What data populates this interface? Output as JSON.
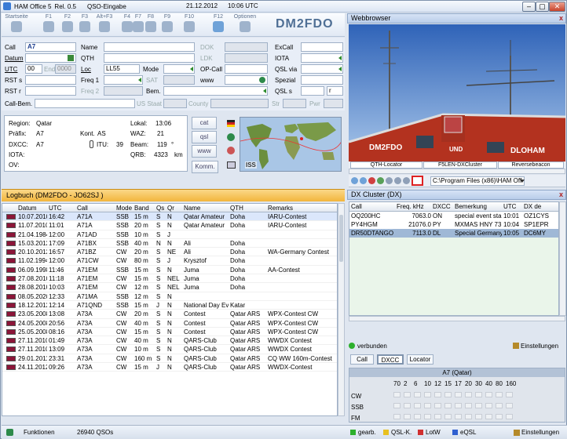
{
  "window": {
    "app": "HAM Office 5",
    "release": "Rel. 0.5",
    "module": "QSO-Eingabe",
    "date": "21.12.2012",
    "time": "10:06 UTC"
  },
  "toolbar": {
    "buttons": [
      {
        "key": "Startseite",
        "icon": "home-icon"
      },
      {
        "key": "F1",
        "icon": "help-icon"
      },
      {
        "key": "F2",
        "icon": "clock-icon"
      },
      {
        "key": "F3",
        "icon": "tune-icon"
      },
      {
        "key": "Alt+F3",
        "icon": "wrench-icon"
      },
      {
        "key": "F4",
        "icon": "edit-icon"
      },
      {
        "key": "F7",
        "icon": "edit2-icon"
      },
      {
        "key": "F8",
        "icon": "settings-icon"
      },
      {
        "key": "F9",
        "icon": "save-icon"
      },
      {
        "key": "F10",
        "icon": "window-icon"
      },
      {
        "key": "F12",
        "icon": "refresh-icon"
      },
      {
        "key": "Optionen",
        "icon": "tools-icon"
      }
    ],
    "own_call": "DM2FDO"
  },
  "form": {
    "call_label": "Call",
    "call_value": "A7",
    "name_label": "Name",
    "dok_label": "DOK",
    "excall_label": "ExCall",
    "datum_label": "Datum",
    "qth_label": "QTH",
    "ldk_label": "LDK",
    "iota_label": "IOTA",
    "utc_label": "UTC",
    "utc_value": "00",
    "end_label": "End",
    "end_value": "0000",
    "loc_label": "Loc",
    "loc_value": "LL55",
    "mode_label": "Mode",
    "opcall_label": "OP-Call",
    "qslvia_label": "QSL via",
    "rsts_label": "RST s",
    "freq1_label": "Freq 1",
    "sat_label": "SAT",
    "www_label": "www",
    "spezial_label": "Spezial",
    "rstr_label": "RST r",
    "freq2_label": "Freq 2",
    "bem_label": "Bem.",
    "qsls_label": "QSL s",
    "qsls_value": "r",
    "callbem_label": "Call-Bem.",
    "usstaat_label": "US Staat",
    "country_label": "County",
    "str_label": "Str",
    "pwr_label": "Pwr"
  },
  "info": {
    "region_label": "Region:",
    "region": "Qatar",
    "prefix_label": "Präfix:",
    "prefix": "A7",
    "dxcc_label": "DXCC:",
    "dxcc": "A7",
    "iota_label": "IOTA:",
    "ov_label": "OV:",
    "lokal_label": "Lokal:",
    "lokal": "13:06",
    "waz_label": "WAZ:",
    "waz": "21",
    "kont_label": "Kont.",
    "kont": "AS",
    "itu_label": "ITU:",
    "itu": "39",
    "beam_label": "Beam:",
    "beam": "119",
    "beam_unit": "°",
    "qrb_label": "QRB:",
    "qrb": "4323",
    "qrb_unit": "km",
    "buttons": [
      "cat",
      "qsl",
      "www",
      "Komm."
    ],
    "map_label": "ISS"
  },
  "logbook": {
    "title": "Logbuch  (DM2FDO - JO62SJ )",
    "columns": [
      "Datum",
      "UTC",
      "Call",
      "Mode",
      "Band",
      "Qs",
      "Qr",
      "Name",
      "QTH",
      "Remarks"
    ],
    "rows": [
      [
        "10.07.2010",
        "16:42",
        "A71A",
        "SSB",
        "15 m",
        "S",
        "N",
        "Qatar Amateur",
        "Doha",
        "IARU-Contest"
      ],
      [
        "11.07.2010",
        "11:01",
        "A71A",
        "SSB",
        "20 m",
        "S",
        "N",
        "Qatar Amateur",
        "Doha",
        "IARU-Contest"
      ],
      [
        "21.04.1984",
        "12:00",
        "A71AD",
        "SSB",
        "10 m",
        "S",
        "J",
        "",
        "",
        ""
      ],
      [
        "15.03.2012",
        "17:09",
        "A71BX",
        "SSB",
        "40 m",
        "N",
        "N",
        "Ali",
        "Doha",
        ""
      ],
      [
        "20.10.2012",
        "16:57",
        "A71BZ",
        "CW",
        "20 m",
        "S",
        "NE",
        "Ali",
        "Doha",
        "WA-Germany Contest"
      ],
      [
        "11.02.1994",
        "12:00",
        "A71CW",
        "CW",
        "80 m",
        "S",
        "J",
        "Krysztof",
        "Doha",
        ""
      ],
      [
        "06.09.1998",
        "11:46",
        "A71EM",
        "SSB",
        "15 m",
        "S",
        "N",
        "Juma",
        "Doha",
        "AA-Contest"
      ],
      [
        "27.08.2010",
        "11:18",
        "A71EM",
        "CW",
        "15 m",
        "S",
        "NEL",
        "Juma",
        "Doha",
        ""
      ],
      [
        "28.08.2010",
        "10:03",
        "A71EM",
        "CW",
        "12 m",
        "S",
        "NEL",
        "Juma",
        "Doha",
        ""
      ],
      [
        "08.05.2020",
        "12:33",
        "A71MA",
        "SSB",
        "12 m",
        "S",
        "N",
        "",
        "",
        ""
      ],
      [
        "18.12.2012",
        "12:14",
        "A71QND",
        "SSB",
        "15 m",
        "J",
        "N",
        "National Day Ev",
        "Katar",
        ""
      ],
      [
        "23.05.2008",
        "13:08",
        "A73A",
        "CW",
        "20 m",
        "S",
        "N",
        "Contest",
        "Qatar ARS",
        "WPX-Contest CW"
      ],
      [
        "24.05.2008",
        "20:56",
        "A73A",
        "CW",
        "40 m",
        "S",
        "N",
        "Contest",
        "Qatar ARS",
        "WPX-Contest CW"
      ],
      [
        "25.05.2008",
        "08:16",
        "A73A",
        "CW",
        "15 m",
        "S",
        "N",
        "Contest",
        "Qatar ARS",
        "WPX-Contest CW"
      ],
      [
        "27.11.2010",
        "01:49",
        "A73A",
        "CW",
        "40 m",
        "S",
        "N",
        "QARS-Club",
        "Qatar ARS",
        "WWDX Contest"
      ],
      [
        "27.11.2010",
        "13:09",
        "A73A",
        "CW",
        "10 m",
        "S",
        "N",
        "QARS-Club",
        "Qatar ARS",
        "WWDX Contest"
      ],
      [
        "29.01.2011",
        "23:31",
        "A73A",
        "CW",
        "160 m",
        "S",
        "N",
        "QARS-Club",
        "Qatar ARS",
        "CQ WW 160m-Contest"
      ],
      [
        "24.11.2012",
        "09:26",
        "A73A",
        "CW",
        "15 m",
        "J",
        "N",
        "QARS-Club",
        "Qatar ARS",
        "WWDX-Contest"
      ]
    ]
  },
  "webbrowser": {
    "title": "Webbrowser",
    "photo_left": "DM2FDO",
    "photo_mid": "UND",
    "photo_right": "DLOHAM",
    "tabs": [
      "QTH-Locator",
      "F5LEN-DXCluster",
      "Reversebeacon"
    ],
    "path": "C:\\Program Files (x86)\\HAM Off"
  },
  "dxcluster": {
    "title": "DX Cluster (DX)",
    "columns": [
      "Call",
      "Freq. kHz",
      "DXCC",
      "Bemerkung",
      "UTC",
      "DX de"
    ],
    "rows": [
      [
        "OQ200HC",
        "7063.0",
        "ON",
        "special event sta",
        "10:01",
        "OZ1CYS"
      ],
      [
        "PY4HGM",
        "21076.0",
        "PY",
        "MXMAS HNY 73",
        "10:04",
        "SP1EPR"
      ],
      [
        "DR50DTANGO",
        "7113.0",
        "DL",
        "Special Germany",
        "10:05",
        "DC6MY"
      ]
    ],
    "connected": "verbunden",
    "settings": "Einstellungen",
    "tabs": [
      "Call",
      "DXCC",
      "Locator"
    ],
    "band_title": "A7 (Qatar)",
    "bands": [
      "70",
      "2",
      "6",
      "10",
      "12",
      "15",
      "17",
      "20",
      "30",
      "40",
      "80",
      "160"
    ],
    "modes": [
      "CW",
      "SSB",
      "FM"
    ]
  },
  "statusbar": {
    "functions": "Funktionen",
    "count": "26940 QSOs",
    "legend": [
      "gearb.",
      "QSL-K.",
      "LotW",
      "eQSL"
    ],
    "settings": "Einstellungen"
  },
  "colors": {
    "row_marker": "#8b1538",
    "logbar": "#f2b53c",
    "accent": "#4f6f95"
  }
}
